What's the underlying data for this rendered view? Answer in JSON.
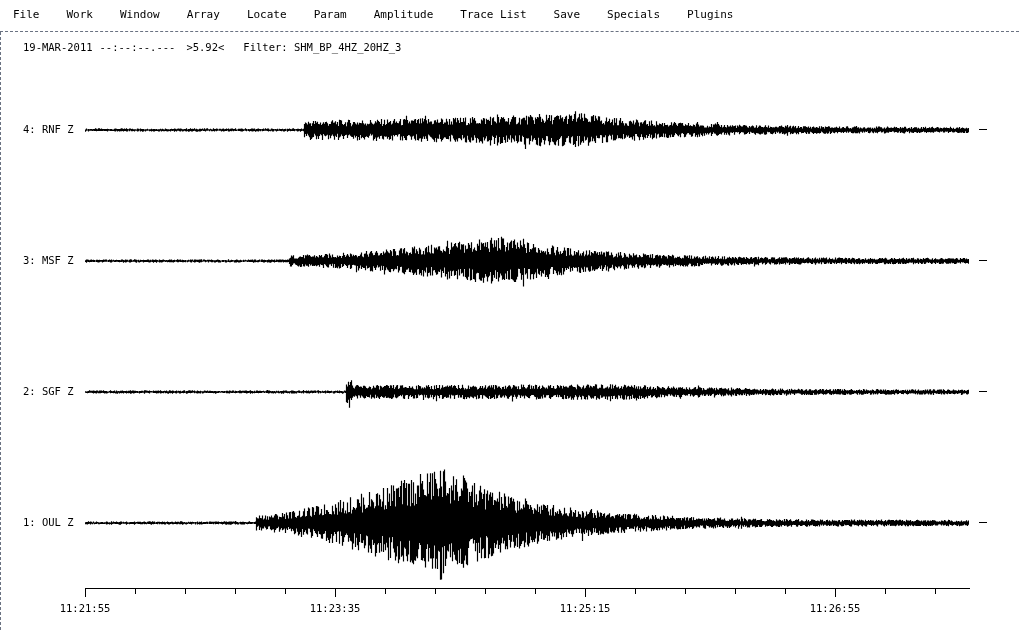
{
  "menu": [
    "File",
    "Work",
    "Window",
    "Array",
    "Locate",
    "Param",
    "Amplitude",
    "Trace List",
    "Save",
    "Specials",
    "Plugins"
  ],
  "header": {
    "date": "19-MAR-2011",
    "time": "--:--:--.---",
    "magnitude": ">5.92<",
    "filter": "Filter: SHM_BP_4HZ_20HZ_3"
  },
  "traces": [
    {
      "label": "4: RNF Z"
    },
    {
      "label": "3: MSF Z"
    },
    {
      "label": "2: SGF Z"
    },
    {
      "label": "1: OUL Z"
    }
  ],
  "time_axis": [
    "11:21:55",
    "11:23:35",
    "11:25:15",
    "11:26:55"
  ]
}
